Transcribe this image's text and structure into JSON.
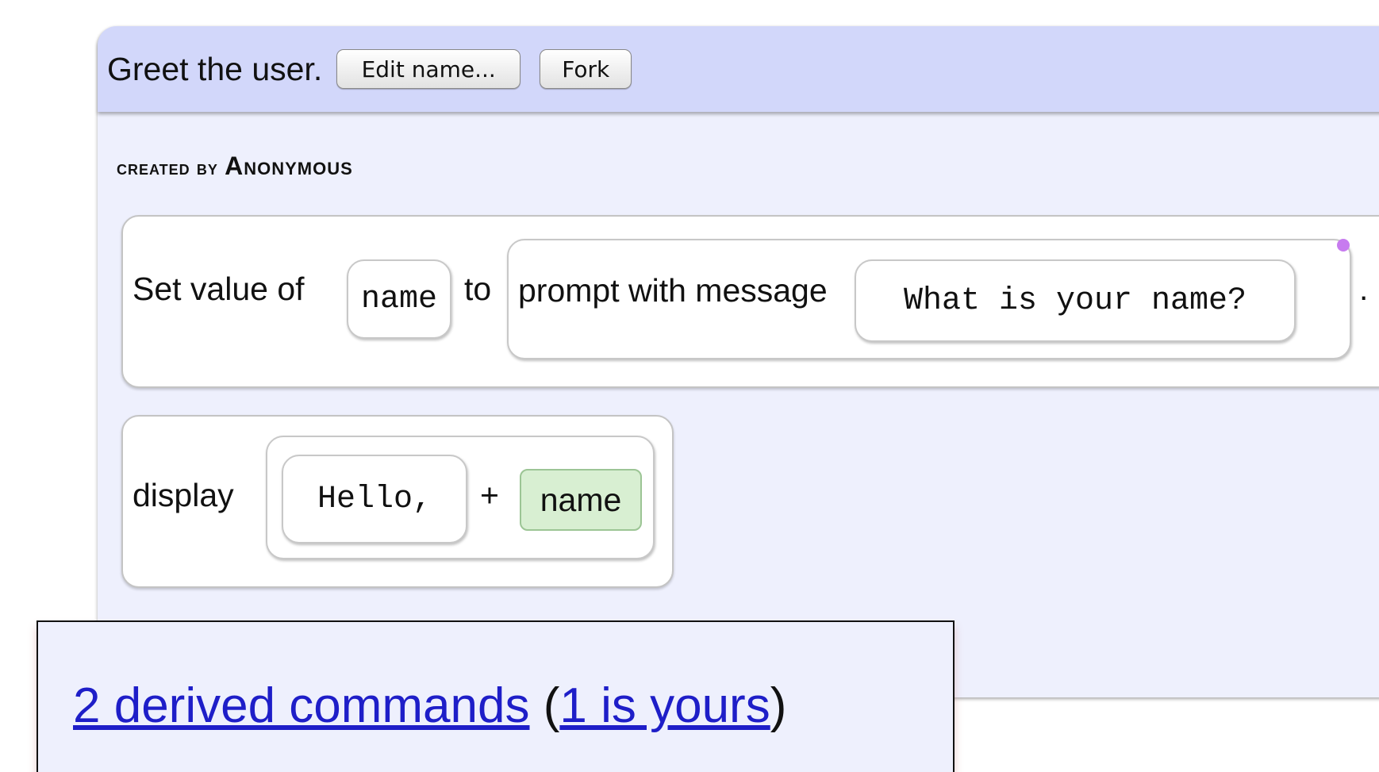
{
  "header": {
    "title": "Greet the user.",
    "edit_name_button": "Edit name...",
    "fork_button": "Fork"
  },
  "meta": {
    "created_by_label": "created by",
    "author": "Anonymous"
  },
  "statement1": {
    "prefix": "Set value of",
    "variable": "name",
    "to_word": "to",
    "prompt_label": "prompt with message",
    "prompt_message": "What is your name?",
    "terminator": "."
  },
  "statement2": {
    "verb": "display",
    "string_value": "Hello,",
    "operator": "+",
    "variable": "name"
  },
  "derived": {
    "link_text": "2 derived commands",
    "open_paren": "(",
    "yours_link_text": "1 is yours",
    "close_paren": ")"
  },
  "colors": {
    "header_bg": "#d2d7fa",
    "panel_bg": "#eef0fd",
    "link": "#1e1ec8",
    "variable_chip_bg": "#d8efd2",
    "handle_dot": "#c77bef"
  }
}
